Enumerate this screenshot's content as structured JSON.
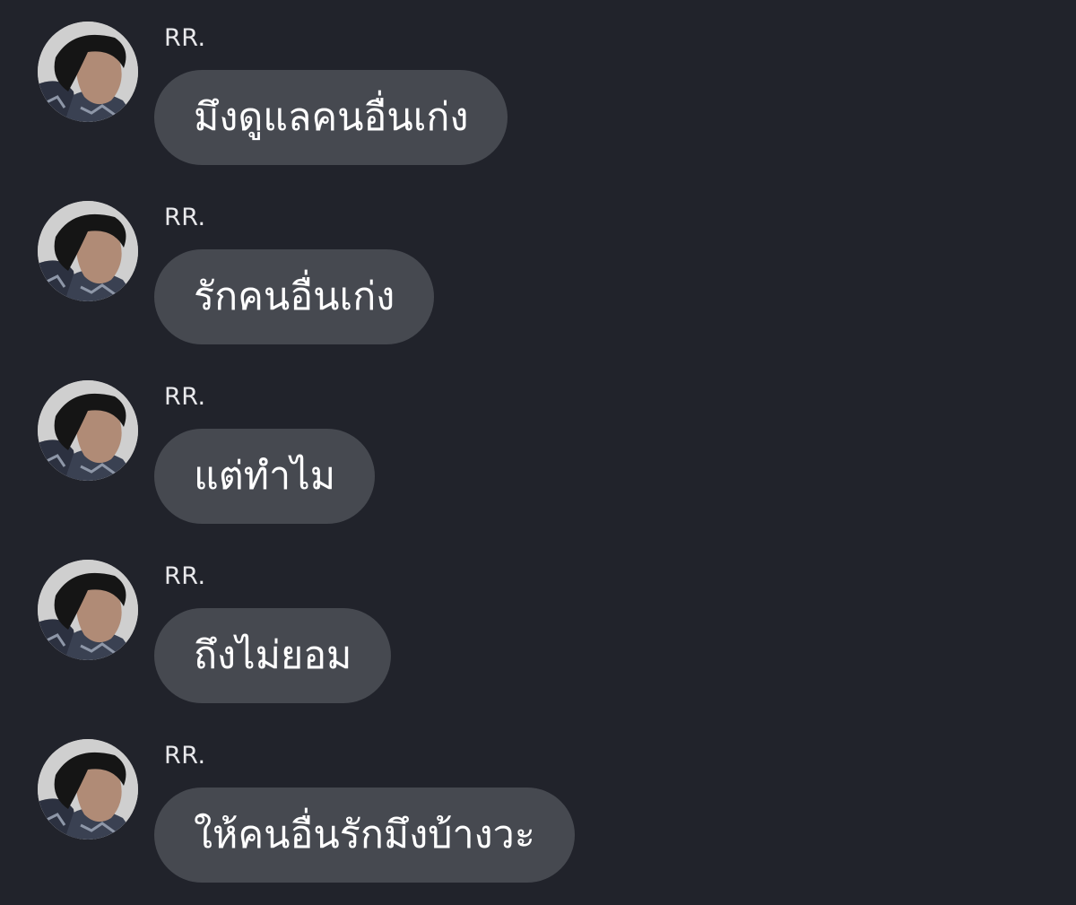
{
  "theme": {
    "background": "#21232b",
    "bubble": "#464950",
    "text": "#ffffff",
    "sender_text": "#e9e9ec"
  },
  "messages": [
    {
      "sender": "RR.",
      "text": "มึงดูแลคนอื่นเก่ง"
    },
    {
      "sender": "RR.",
      "text": "รักคนอื่นเก่ง"
    },
    {
      "sender": "RR.",
      "text": "แต่ทำไม"
    },
    {
      "sender": "RR.",
      "text": "ถึงไม่ยอม"
    },
    {
      "sender": "RR.",
      "text": "ให้คนอื่นรักมึงบ้างวะ"
    }
  ]
}
